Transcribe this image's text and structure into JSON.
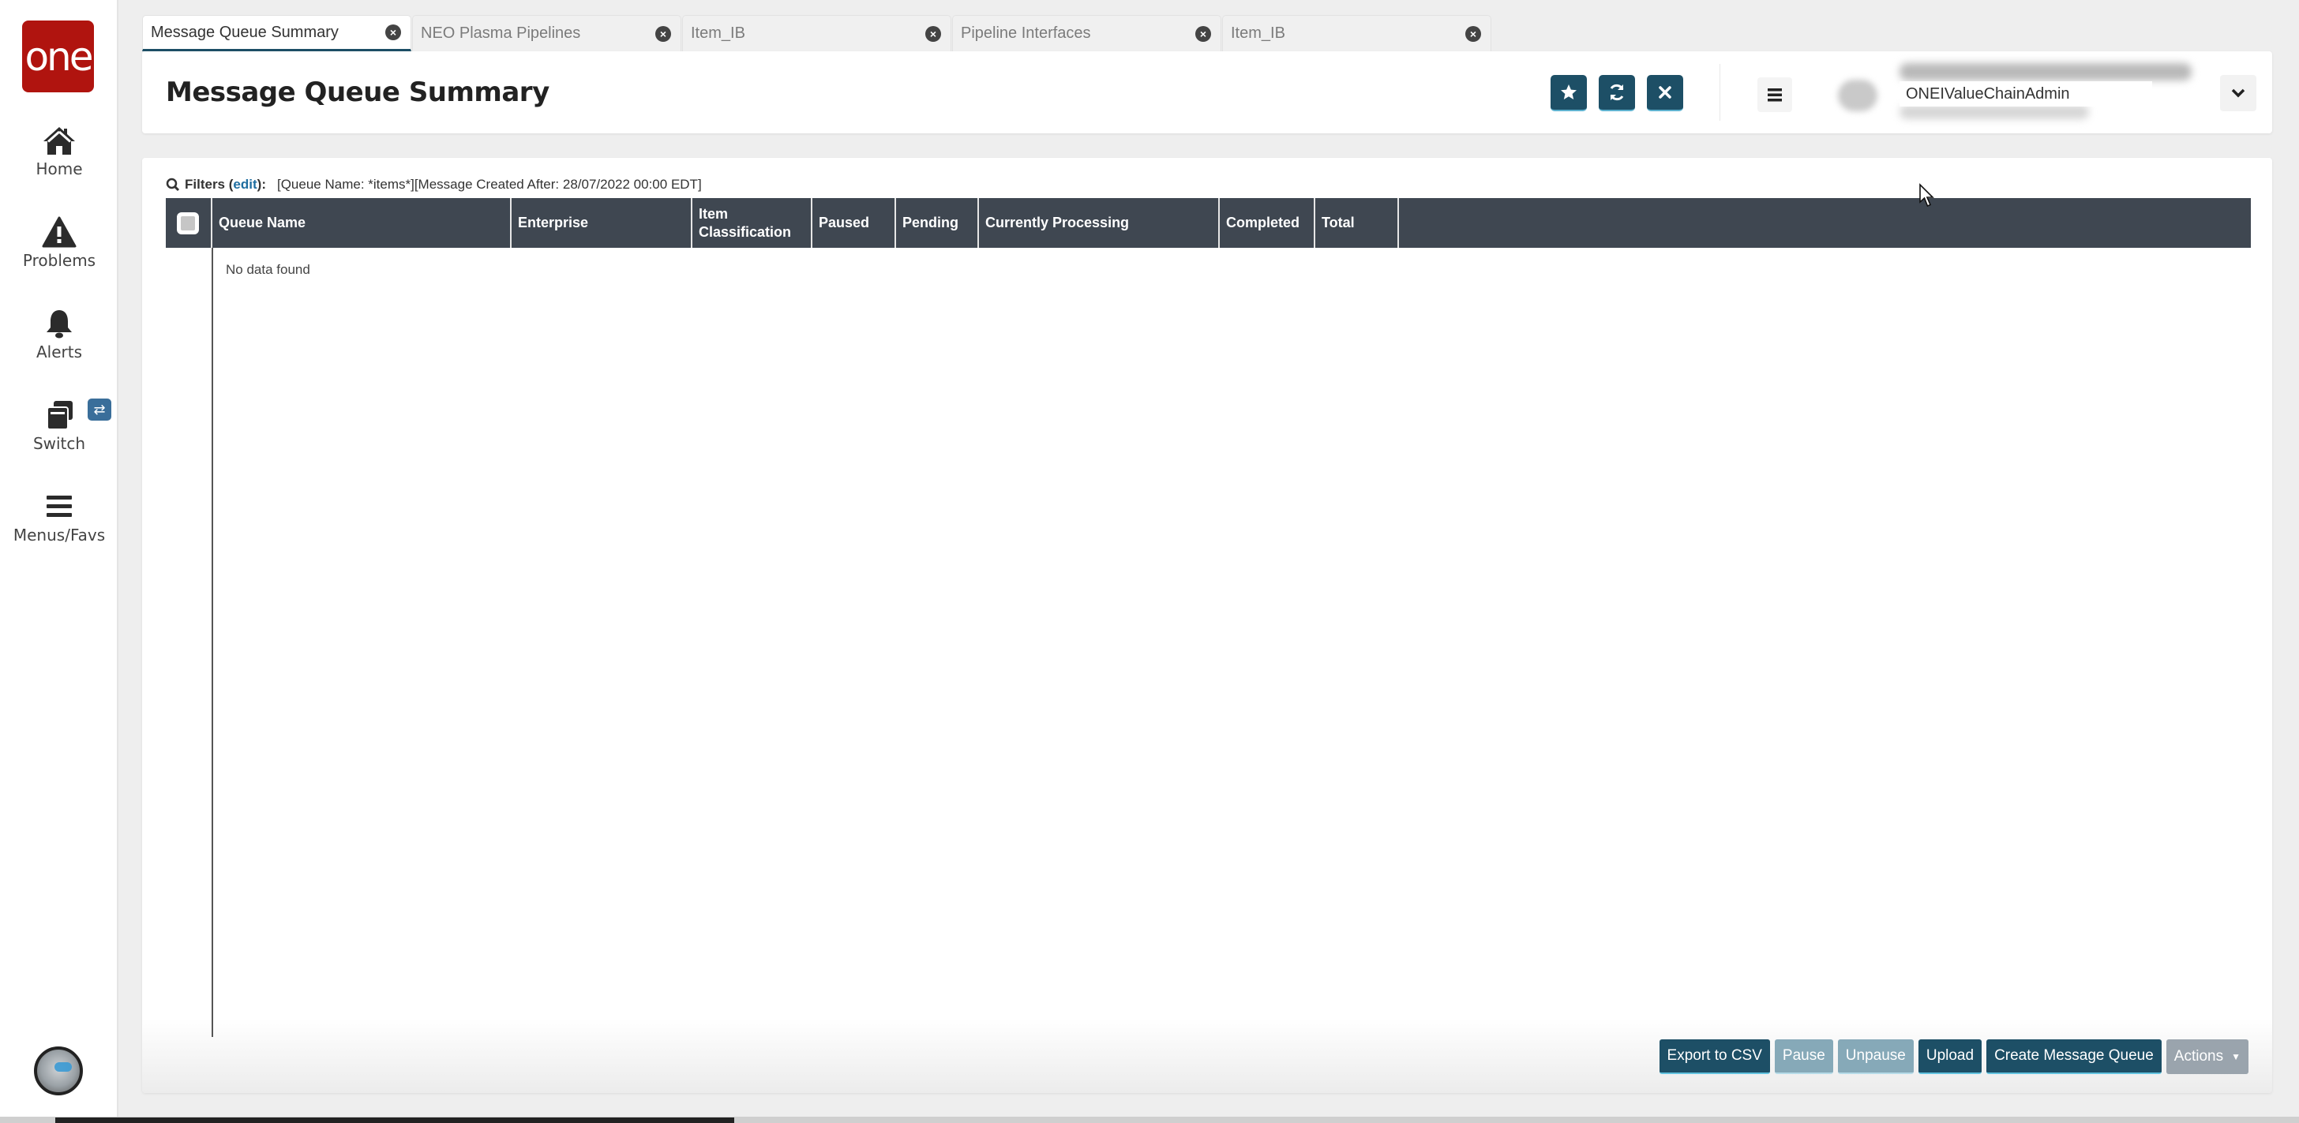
{
  "app": {
    "logo_text": "one",
    "brand_color": "#b0140f",
    "accent_color": "#1d4f66",
    "grid_header_color": "#3f4751"
  },
  "sidebar": {
    "items": [
      {
        "label": "Home",
        "icon": "home-icon"
      },
      {
        "label": "Problems",
        "icon": "warning-icon"
      },
      {
        "label": "Alerts",
        "icon": "bell-icon"
      },
      {
        "label": "Switch",
        "icon": "switch-icon",
        "badge_icon": "swap-arrows-icon"
      },
      {
        "label": "Menus/Favs",
        "icon": "hamburger-icon"
      }
    ]
  },
  "tabs": [
    {
      "label": "Message Queue Summary",
      "active": true
    },
    {
      "label": "NEO Plasma Pipelines",
      "active": false
    },
    {
      "label": "Item_IB",
      "active": false
    },
    {
      "label": "Pipeline Interfaces",
      "active": false
    },
    {
      "label": "Item_IB",
      "active": false
    }
  ],
  "header": {
    "title": "Message Queue Summary",
    "buttons": [
      "favorite-star",
      "refresh",
      "close"
    ],
    "user": {
      "name": "ONEIValueChainAdmin"
    }
  },
  "filters": {
    "label": "Filters",
    "edit_label": "edit",
    "value": "[Queue Name: *items*][Message Created After: 28/07/2022 00:00 EDT]"
  },
  "grid": {
    "columns": [
      "Queue Name",
      "Enterprise",
      "Item Classification",
      "Paused",
      "Pending",
      "Currently Processing",
      "Completed",
      "Total"
    ],
    "rows": [],
    "empty_text": "No data found"
  },
  "footer_buttons": [
    {
      "label": "Export to CSV",
      "state": "enabled"
    },
    {
      "label": "Pause",
      "state": "disabled"
    },
    {
      "label": "Unpause",
      "state": "disabled"
    },
    {
      "label": "Upload",
      "state": "enabled"
    },
    {
      "label": "Create Message Queue",
      "state": "enabled"
    },
    {
      "label": "Actions",
      "state": "menu"
    }
  ]
}
